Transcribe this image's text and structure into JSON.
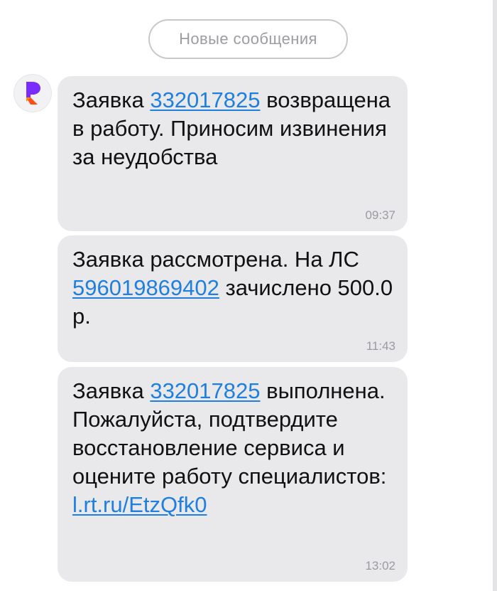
{
  "header": {
    "new_messages_label": "Новые сообщения"
  },
  "sender": {
    "avatar_icon": "rostelecom-logo-icon",
    "brand_colors": [
      "#7a2cff",
      "#ff4f12"
    ]
  },
  "messages": [
    {
      "part1": "Заявка ",
      "link": "332017825",
      "part2": " возвращена в работу. Приносим извинения за неудобства",
      "time": "09:37"
    },
    {
      "part1": "Заявка рассмотрена. На ЛС ",
      "link": "596019869402",
      "part2": " зачислено 500.0 р.",
      "time": "11:43"
    },
    {
      "part1": "Заявка ",
      "link": "332017825",
      "part2": " выполнена. Пожалуйста, подтвердите восстановление сервиса и оцените работу специалистов: ",
      "link2": "l.rt.ru/EtzQfk0",
      "time": "13:02"
    }
  ],
  "colors": {
    "bubble_background": "#e9e9eb",
    "link": "#1f7fe0",
    "timestamp": "#9a9aa0"
  }
}
